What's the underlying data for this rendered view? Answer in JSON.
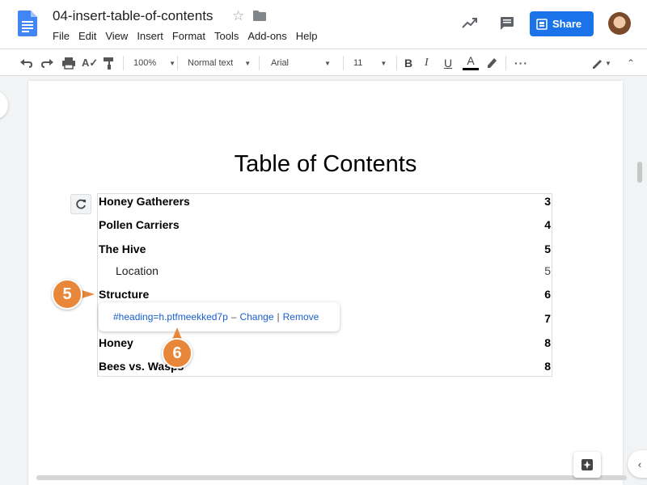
{
  "header": {
    "doc_title": "04-insert-table-of-contents",
    "menu": [
      "File",
      "Edit",
      "View",
      "Insert",
      "Format",
      "Tools",
      "Add-ons",
      "Help"
    ],
    "share_label": "Share",
    "colors": {
      "accent": "#1a73e8",
      "callout": "#e8863a"
    }
  },
  "toolbar": {
    "zoom": "100%",
    "style": "Normal text",
    "font": "Arial",
    "size": "11"
  },
  "document": {
    "toc_title": "Table of Contents",
    "entries": [
      {
        "label": "Honey Gatherers",
        "page": "3",
        "level": 1
      },
      {
        "label": "Pollen Carriers",
        "page": "4",
        "level": 1
      },
      {
        "label": "The Hive",
        "page": "5",
        "level": 1
      },
      {
        "label": "Location",
        "page": "5",
        "level": 2
      },
      {
        "label": "Structure",
        "page": "6",
        "level": 1
      },
      {
        "label": "",
        "page": "7",
        "level": 1
      },
      {
        "label": "Honey",
        "page": "8",
        "level": 1
      },
      {
        "label": "Bees vs. Wasps",
        "page": "8",
        "level": 1
      }
    ]
  },
  "link_popup": {
    "url": "#heading=h.ptfmeekked7p",
    "dash": "–",
    "change": "Change",
    "divider": "|",
    "remove": "Remove"
  },
  "callouts": {
    "step5": "5",
    "step6": "6"
  }
}
